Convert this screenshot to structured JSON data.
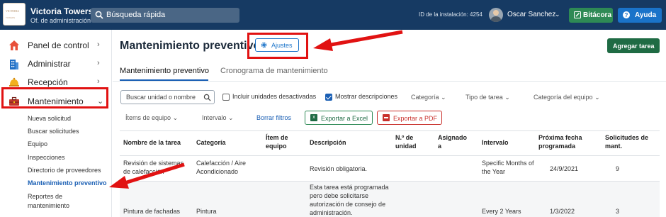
{
  "header": {
    "property_name": "Victoria Towers",
    "property_role": "Of. de administración",
    "logo_text": [
      "VICTORIA",
      "TOWERS"
    ],
    "search_placeholder": "Búsqueda rápida",
    "installation_id": "ID de la instalación: 4254",
    "user_name": "Oscar Sanchez",
    "bitacora_label": "Bitácora",
    "ayuda_label": "Ayuda",
    "colors": {
      "bar": "#163a63",
      "bitacora": "#2e8a55",
      "ayuda": "#1a73c9"
    }
  },
  "sidebar": {
    "items": [
      {
        "label": "Panel de control",
        "icon": "home-icon"
      },
      {
        "label": "Administrar",
        "icon": "building-icon"
      },
      {
        "label": "Recepción",
        "icon": "bell-icon"
      },
      {
        "label": "Mantenimiento",
        "icon": "toolbox-icon",
        "expanded": true
      }
    ],
    "subitems": [
      "Nueva solicitud",
      "Buscar solicitudes",
      "Equipo",
      "Inspecciones",
      "Directorio de proveedores",
      "Mantenimiento preventivo",
      "Reportes de",
      "mantenimiento"
    ],
    "active_subitem": "Mantenimiento preventivo"
  },
  "main": {
    "title": "Mantenimiento preventivo",
    "settings_label": "Ajustes",
    "add_task_label": "Agregar tarea",
    "tabs": [
      {
        "label": "Mantenimiento preventivo",
        "active": true
      },
      {
        "label": "Cronograma de mantenimiento",
        "active": false
      }
    ],
    "filters": {
      "search_placeholder": "Buscar unidad o nombre",
      "include_deactivated": {
        "label": "Incluir unidades desactivadas",
        "checked": false
      },
      "show_descriptions": {
        "label": "Mostrar descripciones",
        "checked": true
      },
      "dropdowns": [
        "Categoría",
        "Tipo de tarea",
        "Categoría del equipo",
        "Ítems de equipo",
        "Intervalo"
      ],
      "clear_label": "Borrar filtros",
      "export_excel_label": "Exportar a Excel",
      "export_pdf_label": "Exportar a PDF"
    },
    "table": {
      "headers": [
        "Nombre de la tarea",
        "Categoría",
        "Ítem de equipo",
        "Descripción",
        "N.º de unidad",
        "Asignado a",
        "Intervalo",
        "Próxima fecha programada",
        "Solicitudes de mant."
      ],
      "rows": [
        {
          "name": "Revisión de sistemas de calefacción",
          "category": "Calefacción / Aire Acondicionado",
          "equipment": "",
          "description": "Revisión obligatoria.",
          "unit": "",
          "assigned": "",
          "interval": "Specific Months of the Year",
          "next_date": "24/9/2021",
          "requests": "9"
        },
        {
          "name": "Pintura de fachadas",
          "category": "Pintura",
          "equipment": "",
          "description": "Esta tarea está programada pero debe solicitarse autorización de consejo de administración.",
          "unit": "",
          "assigned": "",
          "interval": "Every 2 Years",
          "next_date": "1/3/2022",
          "requests": "3"
        }
      ]
    }
  }
}
